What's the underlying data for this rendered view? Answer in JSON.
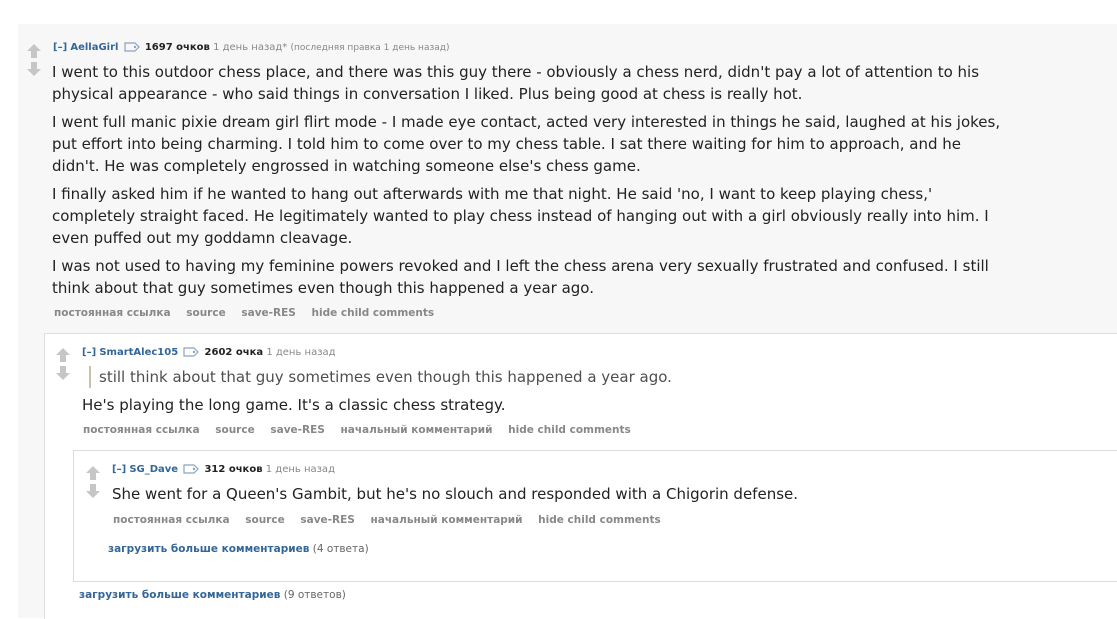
{
  "colors": {
    "link": "#336699",
    "arrow": "#c6c6c6",
    "background": "#f7f7f8"
  },
  "icons": {
    "upvote": "arrow-up",
    "downvote": "arrow-down",
    "user_tag": "tag"
  },
  "comments": [
    {
      "toggle": "[–]",
      "author": "AellaGirl",
      "score": "1697 очков",
      "time": "1 день назад*",
      "edited": "(последняя правка 1 день назад)",
      "paragraphs": [
        "I went to this outdoor chess place, and there was this guy there - obviously a chess nerd, didn't pay a lot of attention to his physical appearance - who said things in conversation I liked. Plus being good at chess is really hot.",
        "I went full manic pixie dream girl flirt mode - I made eye contact, acted very interested in things he said, laughed at his jokes, put effort into being charming. I told him to come over to my chess table. I sat there waiting for him to approach, and he didn't. He was completely engrossed in watching someone else's chess game.",
        "I finally asked him if he wanted to hang out afterwards with me that night. He said 'no, I want to keep playing chess,' completely straight faced. He legitimately wanted to play chess instead of hanging out with a girl obviously really into him. I even puffed out my goddamn cleavage.",
        "I was not used to having my feminine powers revoked and I left the chess arena very sexually frustrated and confused. I still think about that guy sometimes even though this happened a year ago."
      ],
      "buttons": [
        "постоянная ссылка",
        "source",
        "save-RES",
        "hide child comments"
      ]
    },
    {
      "toggle": "[–]",
      "author": "SmartAlec105",
      "score": "2602 очка",
      "time": "1 день назад",
      "quote": "still think about that guy sometimes even though this happened a year ago.",
      "paragraphs": [
        "He's playing the long game. It's a classic chess strategy."
      ],
      "buttons": [
        "постоянная ссылка",
        "source",
        "save-RES",
        "начальный комментарий",
        "hide child comments"
      ]
    },
    {
      "toggle": "[–]",
      "author": "SG_Dave",
      "score": "312 очков",
      "time": "1 день назад",
      "paragraphs": [
        "She went for a Queen's Gambit, but he's no slouch and responded with a Chigorin defense."
      ],
      "buttons": [
        "постоянная ссылка",
        "source",
        "save-RES",
        "начальный комментарий",
        "hide child comments"
      ]
    }
  ],
  "load_more": [
    {
      "label": "загрузить больше комментариев",
      "count": "(4 ответа)"
    },
    {
      "label": "загрузить больше комментариев",
      "count": "(9 ответов)"
    }
  ]
}
